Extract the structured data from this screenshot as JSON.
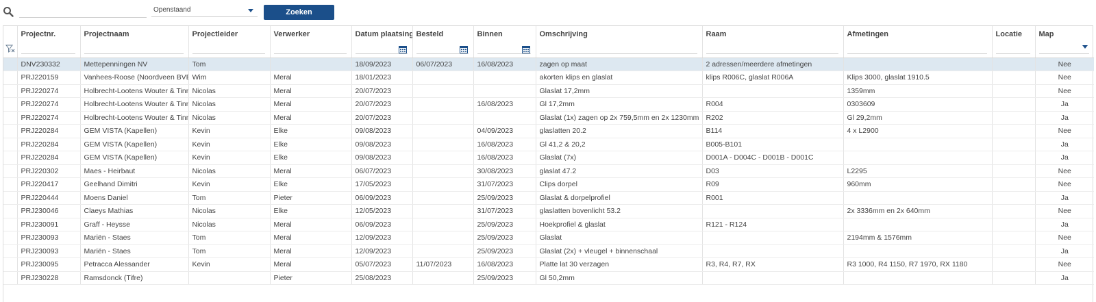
{
  "toolbar": {
    "search_value": "",
    "status_selected": "Openstaand",
    "search_button_label": "Zoeken"
  },
  "columns": [
    "Projectnr.",
    "Projectnaam",
    "Projectleider",
    "Verwerker",
    "Datum plaatsing",
    "Besteld",
    "Binnen",
    "Omschrijving",
    "Raam",
    "Afmetingen",
    "Locatie",
    "Map"
  ],
  "rows": [
    [
      "DNV230332",
      "Mettepenningen NV",
      "Tom",
      "",
      "18/09/2023",
      "06/07/2023",
      "16/08/2023",
      "zagen op maat",
      "2 adressen/meerdere afmetingen",
      "",
      "",
      "Nee"
    ],
    [
      "PRJ220159",
      "Vanhees-Roose (Noordveen BVBA)",
      "Wim",
      "Meral",
      "18/01/2023",
      "",
      "",
      "akorten klips en glaslat",
      "klips R006C, glaslat R006A",
      "Klips 3000, glaslat 1910.5",
      "",
      "Nee"
    ],
    [
      "PRJ220274",
      "Holbrecht-Lootens Wouter & Tinneke",
      "Nicolas",
      "Meral",
      "20/07/2023",
      "",
      "",
      "Glaslat 17,2mm",
      "",
      "1359mm",
      "",
      "Nee"
    ],
    [
      "PRJ220274",
      "Holbrecht-Lootens Wouter & Tinneke",
      "Nicolas",
      "Meral",
      "20/07/2023",
      "",
      "16/08/2023",
      "Gl 17,2mm",
      "R004",
      "0303609",
      "",
      "Ja"
    ],
    [
      "PRJ220274",
      "Holbrecht-Lootens Wouter & Tinneke",
      "Nicolas",
      "Meral",
      "20/07/2023",
      "",
      "",
      "Glaslat (1x) zagen op 2x 759,5mm en 2x 1230mm",
      "R202",
      "Gl 29,2mm",
      "",
      "Ja"
    ],
    [
      "PRJ220284",
      "GEM VISTA (Kapellen)",
      "Kevin",
      "Elke",
      "09/08/2023",
      "",
      "04/09/2023",
      "glaslatten 20.2",
      "B114",
      "4 x L2900",
      "",
      "Nee"
    ],
    [
      "PRJ220284",
      "GEM VISTA (Kapellen)",
      "Kevin",
      "Elke",
      "09/08/2023",
      "",
      "16/08/2023",
      "Gl 41,2 & 20,2",
      "B005-B101",
      "",
      "",
      "Ja"
    ],
    [
      "PRJ220284",
      "GEM VISTA (Kapellen)",
      "Kevin",
      "Elke",
      "09/08/2023",
      "",
      "16/08/2023",
      "Glaslat (7x)",
      "D001A - D004C - D001B - D001C",
      "",
      "",
      "Ja"
    ],
    [
      "PRJ220302",
      "Maes - Heirbaut",
      "Nicolas",
      "Meral",
      "06/07/2023",
      "",
      "30/08/2023",
      "glaslat 47.2",
      "D03",
      "L2295",
      "",
      "Nee"
    ],
    [
      "PRJ220417",
      "Geelhand Dimitri",
      "Kevin",
      "Elke",
      "17/05/2023",
      "",
      "31/07/2023",
      "Clips dorpel",
      "R09",
      "960mm",
      "",
      "Nee"
    ],
    [
      "PRJ220444",
      "Moens Daniel",
      "Tom",
      "Pieter",
      "06/09/2023",
      "",
      "25/09/2023",
      "Glaslat & dorpelprofiel",
      "R001",
      "",
      "",
      "Ja"
    ],
    [
      "PRJ230046",
      "Claeys Mathias",
      "Nicolas",
      "Elke",
      "12/05/2023",
      "",
      "31/07/2023",
      "glaslatten bovenlicht 53.2",
      "",
      "2x 3336mm en 2x 640mm",
      "",
      "Nee"
    ],
    [
      "PRJ230091",
      "Graff - Heysse",
      "Nicolas",
      "Meral",
      "06/09/2023",
      "",
      "25/09/2023",
      "Hoekprofiel & glaslat",
      "R121 - R124",
      "",
      "",
      "Ja"
    ],
    [
      "PRJ230093",
      "Mariën - Staes",
      "Tom",
      "Meral",
      "12/09/2023",
      "",
      "25/09/2023",
      "Glaslat",
      "",
      "2194mm & 1576mm",
      "",
      "Nee"
    ],
    [
      "PRJ230093",
      "Mariën - Staes",
      "Tom",
      "Meral",
      "12/09/2023",
      "",
      "25/09/2023",
      "Glaslat (2x) + vleugel + binnenschaal",
      "",
      "",
      "",
      "Ja"
    ],
    [
      "PRJ230095",
      "Petracca Alessander",
      "Kevin",
      "Meral",
      "05/07/2023",
      "11/07/2023",
      "16/08/2023",
      "Platte lat 30 verzagen",
      "R3, R4, R7, RX",
      "R3 1000, R4 1150, R7 1970, RX 1180",
      "",
      "Nee"
    ],
    [
      "PRJ230228",
      "Ramsdonck (Tifre)",
      "",
      "Pieter",
      "25/08/2023",
      "",
      "25/09/2023",
      "Gl 50,2mm",
      "",
      "",
      "",
      "Ja"
    ]
  ],
  "selected_row": 0,
  "colors": {
    "accent": "#1b4f8a",
    "selected_row": "#dde8f1"
  },
  "icons": {
    "search": "search-icon",
    "calendar": "calendar-icon",
    "clear_filter": "clear-filter-icon",
    "dropdown": "chevron-down-icon"
  }
}
